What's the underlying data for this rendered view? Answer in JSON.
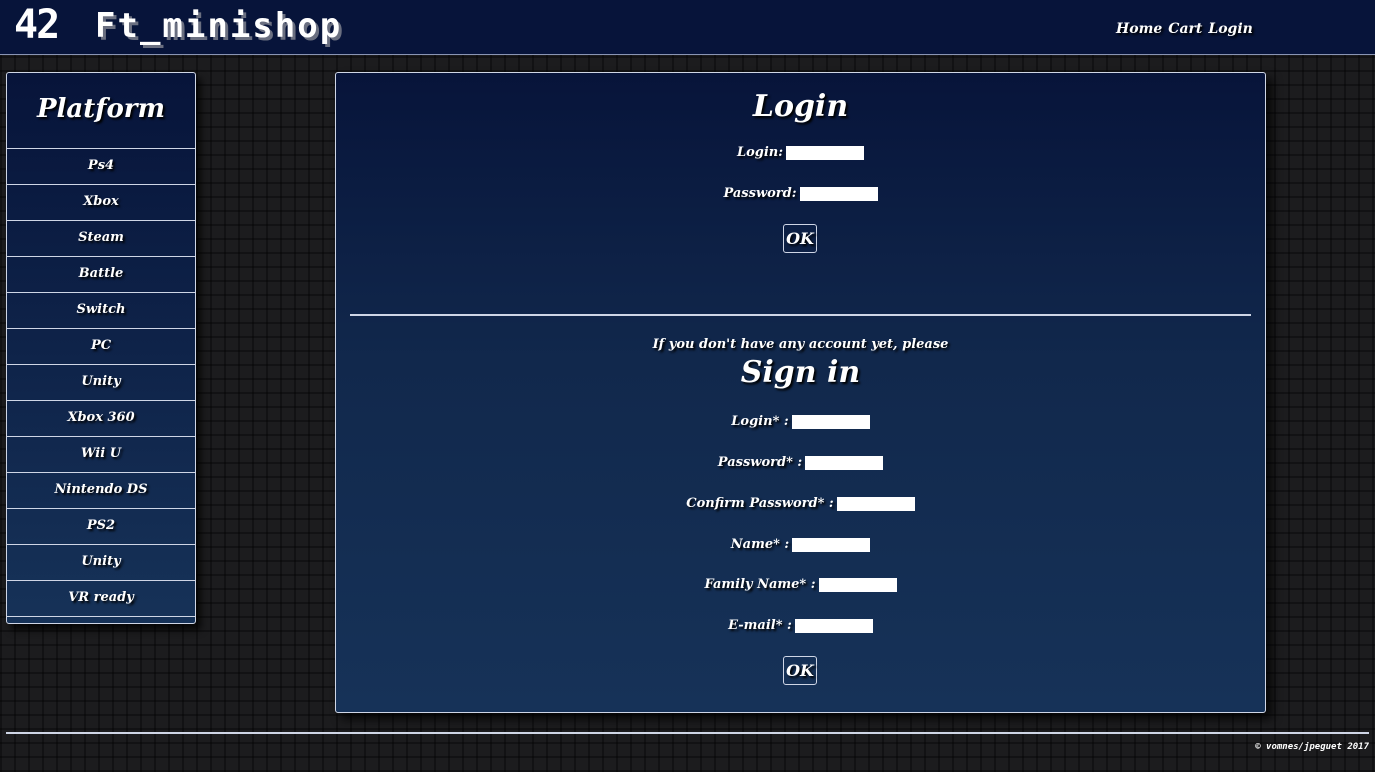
{
  "header": {
    "logo": "42",
    "title": "Ft_minishop",
    "nav": [
      "Home",
      "Cart",
      "Login"
    ]
  },
  "sidebar": {
    "title": "Platform",
    "items": [
      "Ps4",
      "Xbox",
      "Steam",
      "Battle",
      "Switch",
      "PC",
      "Unity",
      "Xbox 360",
      "Wii U",
      "Nintendo DS",
      "PS2",
      "Unity",
      "VR ready"
    ]
  },
  "login": {
    "heading": "Login",
    "login_label": "Login:",
    "password_label": "Password:",
    "ok_label": "OK"
  },
  "signin": {
    "hint": "If you don't have any account yet, please",
    "heading": "Sign in",
    "login_label": "Login* :",
    "password_label": "Password* :",
    "confirm_label": "Confirm Password* :",
    "name_label": "Name* :",
    "family_label": "Family Name* :",
    "email_label": "E-mail* :",
    "ok_label": "OK"
  },
  "footer": {
    "text": "© vomnes/jpeguet 2017"
  },
  "colors": {
    "header_bg": "#07143a",
    "panel_top": "#07143a",
    "panel_bottom": "#163258",
    "text": "#ffffff"
  }
}
